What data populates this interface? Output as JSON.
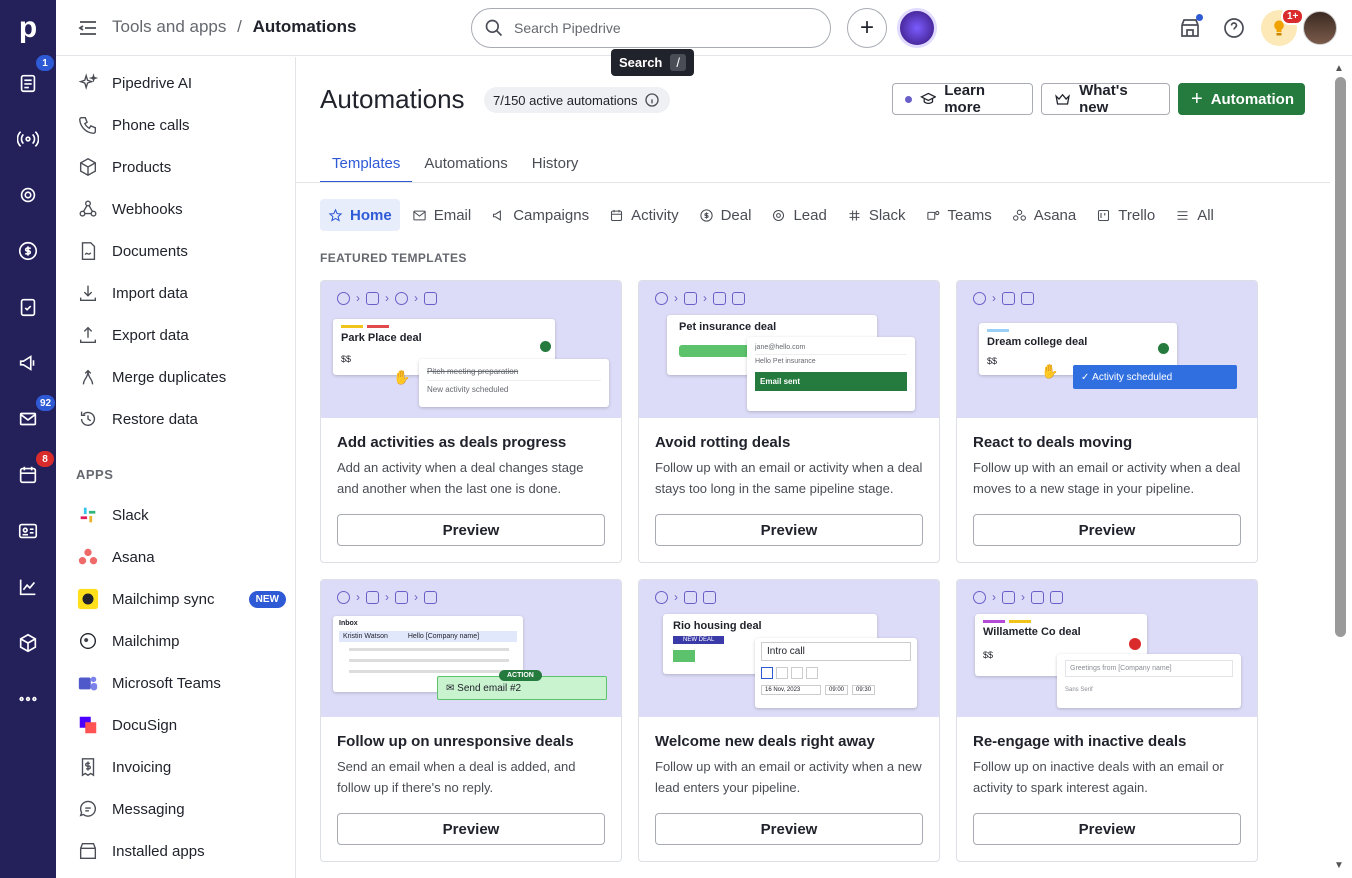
{
  "rail": {
    "logo": "p",
    "badges": {
      "deals": "1",
      "mail": "92",
      "calendar": "8"
    }
  },
  "topbar": {
    "crumb_parent": "Tools and apps",
    "crumb_sep": "/",
    "crumb_current": "Automations",
    "search_placeholder": "Search Pipedrive",
    "tooltip_label": "Search",
    "tooltip_key": "/",
    "notif_badge": "1+"
  },
  "sidebar": {
    "tools": [
      "Pipedrive AI",
      "Phone calls",
      "Products",
      "Webhooks",
      "Documents",
      "Import data",
      "Export data",
      "Merge duplicates",
      "Restore data"
    ],
    "apps_heading": "APPS",
    "apps": [
      "Slack",
      "Asana",
      "Mailchimp sync",
      "Mailchimp",
      "Microsoft Teams",
      "DocuSign",
      "Invoicing",
      "Messaging",
      "Installed apps"
    ],
    "new_badge": "NEW"
  },
  "main": {
    "title": "Automations",
    "active_count": "7/150 active automations",
    "learn_more": "Learn more",
    "whats_new": "What's new",
    "add_automation": "Automation",
    "tabs": [
      "Templates",
      "Automations",
      "History"
    ],
    "categories": [
      "Home",
      "Email",
      "Campaigns",
      "Activity",
      "Deal",
      "Lead",
      "Slack",
      "Teams",
      "Asana",
      "Trello",
      "All"
    ],
    "featured_heading": "FEATURED TEMPLATES",
    "preview_label": "Preview",
    "cards": [
      {
        "title": "Add activities as deals progress",
        "desc": "Add an activity when a deal changes stage and another when the last one is done.",
        "deal": "Park Place deal",
        "amount": "$$",
        "l1": "Pitch meeting preparation",
        "l2": "New activity scheduled"
      },
      {
        "title": "Avoid rotting deals",
        "desc": "Follow up with an email or activity when a deal stays too long in the same pipeline stage.",
        "deal": "Pet insurance deal",
        "email": "jane@hello.com",
        "subject": "Hello Pet insurance",
        "status": "Email sent"
      },
      {
        "title": "React to deals moving",
        "desc": "Follow up with an email or activity when a deal moves to a new stage in your pipeline.",
        "deal": "Dream college deal",
        "amount": "$$",
        "status": "Activity scheduled"
      },
      {
        "title": "Follow up on unresponsive deals",
        "desc": "Send an email when a deal is added, and follow up if there's no reply.",
        "inbox": "Inbox",
        "contact": "Kristin Watson",
        "subject": "Hello [Company name]",
        "action": "ACTION",
        "email": "Send email #2"
      },
      {
        "title": "Welcome new deals right away",
        "desc": "Follow up with an email or activity when a new lead enters your pipeline.",
        "deal": "Rio housing deal",
        "badge": "NEW DEAL",
        "activity": "Intro call",
        "date": "16 Nov, 2023",
        "t1": "09:00",
        "t2": "09:30"
      },
      {
        "title": "Re-engage with inactive deals",
        "desc": "Follow up on inactive deals with an email or activity to spark interest again.",
        "deal": "Willamette Co deal",
        "amount": "$$",
        "greeting": "Greetings from [Company name]",
        "font": "Sans Serif"
      }
    ]
  }
}
